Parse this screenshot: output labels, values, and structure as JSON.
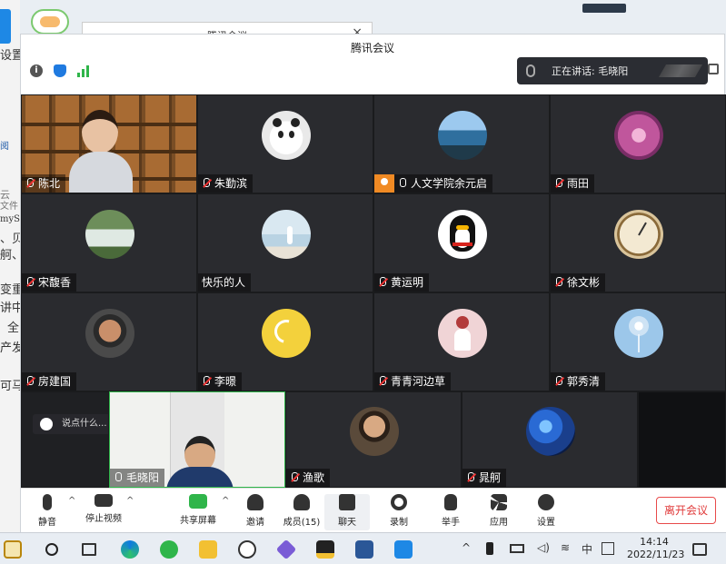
{
  "desktop": {
    "left_texts": [
      "设置",
      "阅",
      "云",
      "文件",
      "myS",
      "、贝",
      "舸、",
      "变重",
      "讲中",
      "全",
      "产发",
      "可马"
    ]
  },
  "back_window": {
    "title": "腾讯会议",
    "close": "×"
  },
  "window": {
    "title": "腾讯会议",
    "speaking_label": "正在讲话: 毛晓阳"
  },
  "participants": [
    {
      "name": "陈北",
      "avatar": "camera-bookshelf",
      "mic": "off"
    },
    {
      "name": "朱勤滨",
      "avatar": "panda",
      "color": "#e9e9e9",
      "mic": "off"
    },
    {
      "name": "人文学院余元启",
      "avatar": "sea",
      "color": "#3b7fb5",
      "mic": "on",
      "host": true
    },
    {
      "name": "雨田",
      "avatar": "flower",
      "color": "#c0569c",
      "mic": "off"
    },
    {
      "name": "宋馥香",
      "avatar": "waterfall",
      "color": "#6d8e5a",
      "mic": "off"
    },
    {
      "name": "快乐的人",
      "avatar": "beach",
      "color": "#b9d3e3",
      "mic": "none"
    },
    {
      "name": "黄运明",
      "avatar": "penguin",
      "color": "#ffffff",
      "mic": "off"
    },
    {
      "name": "徐文彬",
      "avatar": "gauge",
      "color": "#d9c49b",
      "mic": "off"
    },
    {
      "name": "房建国",
      "avatar": "person",
      "color": "#4a4a4a",
      "mic": "off"
    },
    {
      "name": "李暻",
      "avatar": "moon",
      "color": "#f3d13c",
      "mic": "off"
    },
    {
      "name": "青青河边草",
      "avatar": "girl",
      "color": "#f0d4d6",
      "mic": "off"
    },
    {
      "name": "郭秀清",
      "avatar": "dandelion",
      "color": "#9cc7ea",
      "mic": "off"
    },
    {
      "name": "毛晓阳",
      "avatar": "camera-man",
      "mic": "on"
    },
    {
      "name": "渔歌",
      "avatar": "boy",
      "color": "#5a4a3a",
      "mic": "off"
    },
    {
      "name": "晁舸",
      "avatar": "jellyfish",
      "color": "#1a3f8c",
      "mic": "off"
    }
  ],
  "chat": {
    "placeholder": "说点什么...",
    "arrow": "‹"
  },
  "toolbar": {
    "mute": "静音",
    "stop_video": "停止视频",
    "share_screen": "共享屏幕",
    "invite": "邀请",
    "members": "成员(15)",
    "chat": "聊天",
    "record": "录制",
    "raise_hand": "举手",
    "apps": "应用",
    "settings": "设置",
    "leave": "离开会议"
  },
  "taskbar": {
    "tray_ime": "中",
    "time": "14:14",
    "date": "2022/11/23"
  }
}
